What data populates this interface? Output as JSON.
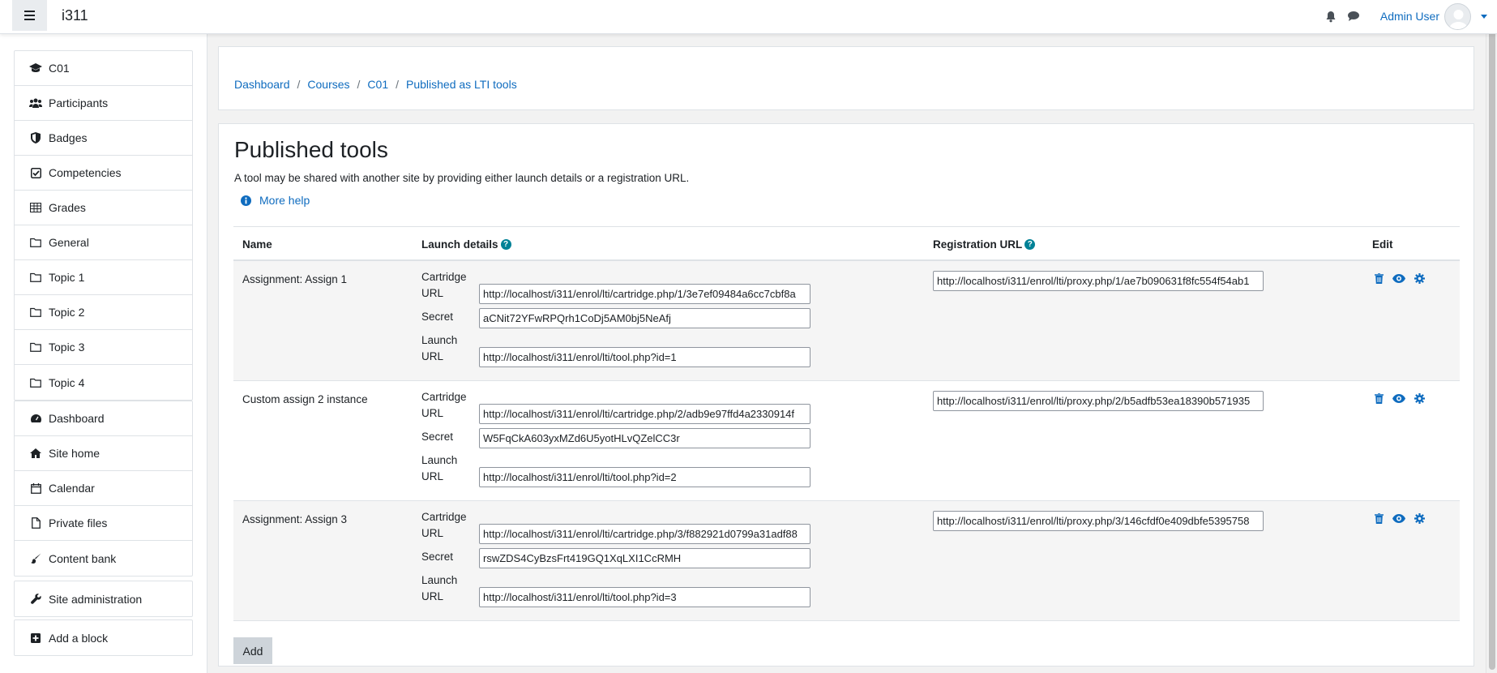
{
  "navbar": {
    "site_name": "i311",
    "user_name": "Admin User"
  },
  "drawer": {
    "course_items": [
      {
        "label": "C01",
        "icon": "graduation-cap-icon"
      },
      {
        "label": "Participants",
        "icon": "users-icon"
      },
      {
        "label": "Badges",
        "icon": "shield-icon"
      },
      {
        "label": "Competencies",
        "icon": "check-square-icon"
      },
      {
        "label": "Grades",
        "icon": "table-icon"
      },
      {
        "label": "General",
        "icon": "folder-icon"
      },
      {
        "label": "Topic 1",
        "icon": "folder-icon"
      },
      {
        "label": "Topic 2",
        "icon": "folder-icon"
      },
      {
        "label": "Topic 3",
        "icon": "folder-icon"
      },
      {
        "label": "Topic 4",
        "icon": "folder-icon"
      }
    ],
    "site_items": [
      {
        "label": "Dashboard",
        "icon": "dashboard-icon"
      },
      {
        "label": "Site home",
        "icon": "home-icon"
      },
      {
        "label": "Calendar",
        "icon": "calendar-icon"
      },
      {
        "label": "Private files",
        "icon": "file-icon"
      },
      {
        "label": "Content bank",
        "icon": "paint-brush-icon"
      }
    ],
    "admin_item": {
      "label": "Site administration",
      "icon": "wrench-icon"
    },
    "block_item": {
      "label": "Add a block",
      "icon": "plus-square-icon"
    }
  },
  "breadcrumb": [
    "Dashboard",
    "Courses",
    "C01",
    "Published as LTI tools"
  ],
  "main": {
    "title": "Published tools",
    "intro": "A tool may be shared with another site by providing either launch details or a registration URL.",
    "more_help": "More help",
    "add_label": "Add"
  },
  "table": {
    "headers": {
      "name": "Name",
      "launch": "Launch details",
      "registration": "Registration URL",
      "edit": "Edit"
    },
    "labels": {
      "cartridge": "Cartridge",
      "url": "URL",
      "secret": "Secret",
      "launch": "Launch"
    },
    "rows": [
      {
        "name": "Assignment: Assign 1",
        "cartridge_url": "http://localhost/i311/enrol/lti/cartridge.php/1/3e7ef09484a6cc7cbf8a",
        "secret": "aCNit72YFwRPQrh1CoDj5AM0bj5NeAfj",
        "launch_url": "http://localhost/i311/enrol/lti/tool.php?id=1",
        "registration_url": "http://localhost/i311/enrol/lti/proxy.php/1/ae7b090631f8fc554f54ab1"
      },
      {
        "name": "Custom assign 2 instance",
        "cartridge_url": "http://localhost/i311/enrol/lti/cartridge.php/2/adb9e97ffd4a2330914f",
        "secret": "W5FqCkA603yxMZd6U5yotHLvQZelCC3r",
        "launch_url": "http://localhost/i311/enrol/lti/tool.php?id=2",
        "registration_url": "http://localhost/i311/enrol/lti/proxy.php/2/b5adfb53ea18390b571935"
      },
      {
        "name": "Assignment: Assign 3",
        "cartridge_url": "http://localhost/i311/enrol/lti/cartridge.php/3/f882921d0799a31adf88",
        "secret": "rswZDS4CyBzsFrt419GQ1XqLXI1CcRMH",
        "launch_url": "http://localhost/i311/enrol/lti/tool.php?id=3",
        "registration_url": "http://localhost/i311/enrol/lti/proxy.php/3/146cfdf0e409dbfe5395758"
      }
    ]
  },
  "colors": {
    "link": "#0f6cbf",
    "help_icon": "#008196"
  }
}
